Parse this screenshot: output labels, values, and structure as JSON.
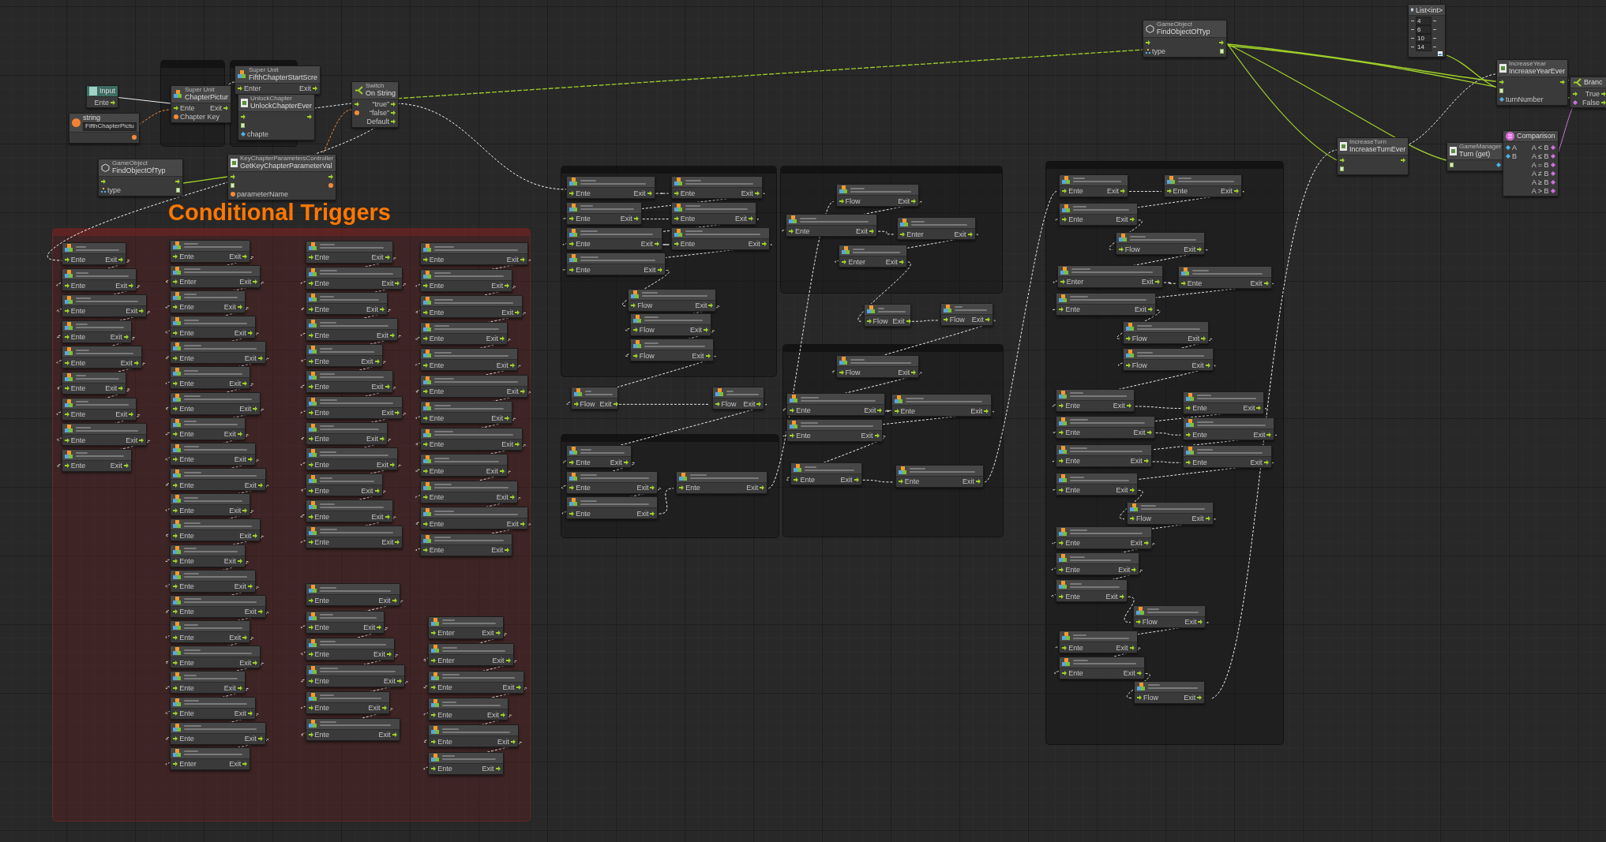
{
  "title_label": "Conditional Triggers",
  "top_nodes": [
    {
      "kind": "input",
      "title": "Input",
      "rows": [
        {
          "right": {
            "kind": "flow",
            "label": "Ente"
          }
        }
      ]
    },
    {
      "kind": "literal",
      "title": "string",
      "value": "FifthChapterPictu",
      "rows": [
        {
          "right": {
            "kind": "string"
          }
        }
      ]
    },
    {
      "kind": "super",
      "category": "Super Unit",
      "title": "ChapterPictur",
      "rows": [
        {
          "left": {
            "kind": "flow",
            "label": "Ente"
          },
          "right": {
            "kind": "flow",
            "label": "Exit"
          }
        },
        {
          "left": {
            "kind": "string",
            "label": "Chapter Key"
          }
        }
      ]
    },
    {
      "kind": "super",
      "category": "Super Unit",
      "title": "FifthChapterStartScre",
      "rows": [
        {
          "left": {
            "kind": "flow",
            "label": "Enter"
          },
          "right": {
            "kind": "flow",
            "label": "Exit"
          }
        }
      ]
    },
    {
      "kind": "script",
      "category": "UnlockChapter",
      "title": "UnlockChapterEver",
      "rows": [
        {
          "left": {
            "kind": "flow"
          },
          "right": {
            "kind": "flow"
          }
        },
        {
          "left": {
            "kind": "object"
          }
        },
        {
          "left": {
            "kind": "int",
            "label": "chapte"
          }
        }
      ]
    },
    {
      "kind": "switch",
      "category": "Switch",
      "title": "On String",
      "rows": [
        {
          "left": {
            "kind": "flow"
          },
          "right": {
            "kind": "flow",
            "label": "“true”"
          }
        },
        {
          "left": {
            "kind": "string"
          },
          "right": {
            "kind": "flow",
            "label": "“false”"
          }
        },
        {
          "right": {
            "kind": "flow",
            "label": "Default"
          }
        }
      ]
    },
    {
      "kind": "gameobject",
      "category": "GameObject",
      "title": "FindObjectOfTyp",
      "rows": [
        {
          "left": {
            "kind": "flow"
          },
          "right": {
            "kind": "flow"
          }
        },
        {
          "left": {
            "kind": "type",
            "label": "type"
          },
          "right": {
            "kind": "object"
          }
        }
      ]
    },
    {
      "kind": "script",
      "category": "KeyChapterParametersController",
      "title": "GetKeyChapterParameterVal",
      "rows": [
        {
          "left": {
            "kind": "flow"
          },
          "right": {
            "kind": "flow"
          }
        },
        {
          "left": {
            "kind": "object"
          },
          "right": {
            "kind": "string"
          }
        },
        {
          "left": {
            "kind": "string",
            "label": "parameterName"
          }
        }
      ]
    },
    {
      "kind": "gameobject",
      "category": "GameObject",
      "title": "FindObjectOfTyp",
      "rows": [
        {
          "left": {
            "kind": "flow"
          },
          "right": {
            "kind": "flow"
          }
        },
        {
          "left": {
            "kind": "type",
            "label": "type"
          },
          "right": {
            "kind": "object"
          }
        }
      ]
    },
    {
      "kind": "script",
      "category": "IncreaseYear",
      "title": "IncreaseYearEver",
      "rows": [
        {
          "left": {
            "kind": "flow"
          },
          "right": {
            "kind": "flow"
          }
        },
        {
          "left": {
            "kind": "object"
          }
        },
        {
          "left": {
            "kind": "int",
            "label": "turnNumber"
          }
        }
      ]
    },
    {
      "kind": "branch",
      "title": "Branc",
      "rows": [
        {
          "left": {
            "kind": "flow"
          },
          "right": {
            "kind": "flow",
            "label": "True"
          }
        },
        {
          "left": {
            "kind": "bool"
          },
          "right": {
            "kind": "flow",
            "label": "False"
          }
        }
      ]
    },
    {
      "kind": "script",
      "category": "IncreaseTurn",
      "title": "IncreaseTurnEver",
      "rows": [
        {
          "left": {
            "kind": "flow"
          },
          "right": {
            "kind": "flow"
          }
        },
        {
          "left": {
            "kind": "object"
          }
        }
      ]
    },
    {
      "kind": "script",
      "category": "GameManager",
      "title": "Turn (get)",
      "rows": [
        {
          "left": {
            "kind": "object"
          },
          "right": {
            "kind": "int"
          }
        }
      ]
    },
    {
      "kind": "comparison",
      "title": "Comparison",
      "rows": [
        {
          "left": {
            "kind": "int",
            "label": "A"
          },
          "right": {
            "kind": "bool",
            "label": "A < B"
          }
        },
        {
          "left": {
            "kind": "int",
            "label": "B"
          },
          "right": {
            "kind": "bool",
            "label": "A ≤ B"
          }
        },
        {
          "right": {
            "kind": "bool",
            "label": "A = B"
          }
        },
        {
          "right": {
            "kind": "bool",
            "label": "A ≠ B"
          }
        },
        {
          "right": {
            "kind": "bool",
            "label": "A ≥ B"
          }
        },
        {
          "right": {
            "kind": "bool",
            "label": "A > B"
          }
        }
      ]
    }
  ],
  "list_node": {
    "title": "List<int>",
    "items": [
      "4",
      "6",
      "10",
      "14"
    ]
  },
  "trigger_columns": [
    {
      "nodes": [
        {
          "enter": "Ente",
          "exit": "Exit"
        },
        {
          "enter": "Ente",
          "exit": "Exit"
        },
        {
          "enter": "Ente",
          "exit": "Exit"
        },
        {
          "enter": "Ente",
          "exit": "Exit"
        },
        {
          "enter": "Ente",
          "exit": "Exit"
        },
        {
          "enter": "Ente",
          "exit": "Exit"
        },
        {
          "enter": "Ente",
          "exit": "Exit"
        },
        {
          "enter": "Ente",
          "exit": "Exit"
        },
        {
          "enter": "Ente",
          "exit": "Exit"
        }
      ]
    },
    {
      "nodes": [
        {
          "enter": "Ente",
          "exit": "Exit"
        },
        {
          "enter": "Enter",
          "exit": "Exit"
        },
        {
          "enter": "Ente",
          "exit": "Exit"
        },
        {
          "enter": "Ente",
          "exit": "Exit"
        },
        {
          "enter": "Ente",
          "exit": "Exit"
        },
        {
          "enter": "Ente",
          "exit": "Exit"
        },
        {
          "enter": "Ente",
          "exit": "Exit"
        },
        {
          "enter": "Ente",
          "exit": "Exit"
        },
        {
          "enter": "Ente",
          "exit": "Exit"
        },
        {
          "enter": "Ente",
          "exit": "Exit"
        },
        {
          "enter": "Ente",
          "exit": "Exit"
        },
        {
          "enter": "Ente",
          "exit": "Exit"
        },
        {
          "enter": "Ente",
          "exit": "Exit"
        },
        {
          "enter": "Ente",
          "exit": "Exit"
        },
        {
          "enter": "Ente",
          "exit": "Exit"
        },
        {
          "enter": "Ente",
          "exit": "Exit"
        },
        {
          "enter": "Ente",
          "exit": "Exit"
        },
        {
          "enter": "Ente",
          "exit": "Exit"
        },
        {
          "enter": "Ente",
          "exit": "Exit"
        },
        {
          "enter": "Ente",
          "exit": "Exit"
        },
        {
          "enter": "Enter",
          "exit": "Exit"
        }
      ]
    },
    {
      "nodes": [
        {
          "enter": "Ente",
          "exit": "Exit"
        },
        {
          "enter": "Ente",
          "exit": "Exit"
        },
        {
          "enter": "Ente",
          "exit": "Exit"
        },
        {
          "enter": "Ente",
          "exit": "Exit"
        },
        {
          "enter": "Ente",
          "exit": "Exit"
        },
        {
          "enter": "Ente",
          "exit": "Exit"
        },
        {
          "enter": "Ente",
          "exit": "Exit"
        },
        {
          "enter": "Ente",
          "exit": "Exit"
        },
        {
          "enter": "Ente",
          "exit": "Exit"
        },
        {
          "enter": "Ente",
          "exit": "Exit"
        },
        {
          "enter": "Ente",
          "exit": "Exit"
        },
        {
          "enter": "Ente",
          "exit": "Exit"
        }
      ]
    },
    {
      "nodes": [
        {
          "enter": "Ente",
          "exit": "Exit"
        },
        {
          "enter": "Ente",
          "exit": "Exit"
        },
        {
          "enter": "Ente",
          "exit": "Exit"
        },
        {
          "enter": "Ente",
          "exit": "Exit"
        },
        {
          "enter": "Ente",
          "exit": "Exit"
        },
        {
          "enter": "Ente",
          "exit": "Exit"
        }
      ]
    },
    {
      "nodes": [
        {
          "enter": "Ente",
          "exit": "Exit"
        },
        {
          "enter": "Ente",
          "exit": "Exit"
        },
        {
          "enter": "Ente",
          "exit": "Exit"
        },
        {
          "enter": "Ente",
          "exit": "Exit"
        },
        {
          "enter": "Ente",
          "exit": "Exit"
        },
        {
          "enter": "Ente",
          "exit": "Exit"
        },
        {
          "enter": "Ente",
          "exit": "Exit"
        },
        {
          "enter": "Ente",
          "exit": "Exit"
        },
        {
          "enter": "Ente",
          "exit": "Exit"
        },
        {
          "enter": "Ente",
          "exit": "Exit"
        },
        {
          "enter": "Ente",
          "exit": "Exit"
        },
        {
          "enter": "Ente",
          "exit": "Exit"
        }
      ]
    },
    {
      "nodes": [
        {
          "enter": "Enter",
          "exit": "Exit"
        },
        {
          "enter": "Enter",
          "exit": "Exit"
        },
        {
          "enter": "Ente",
          "exit": "Exit"
        },
        {
          "enter": "Ente",
          "exit": "Exit"
        },
        {
          "enter": "Ente",
          "exit": "Exit"
        },
        {
          "enter": "Ente",
          "exit": "Exit"
        }
      ]
    }
  ],
  "unit_nodes": [
    {
      "enter": "Ente",
      "exit": "Exit"
    },
    {
      "enter": "Ente",
      "exit": "Exit"
    },
    {
      "enter": "Ente",
      "exit": "Exit"
    },
    {
      "enter": "Ente",
      "exit": "Exit"
    },
    {
      "enter": "Ente",
      "exit": "Exit"
    },
    {
      "enter": "Ente",
      "exit": "Exit"
    },
    {
      "enter": "Ente",
      "exit": "Exit"
    },
    {
      "enter": "Flow",
      "exit": "Exit"
    },
    {
      "enter": "Flow",
      "exit": "Exit"
    },
    {
      "enter": "Flow",
      "exit": "Exit"
    },
    {
      "enter": "Flow",
      "exit": "Exit"
    },
    {
      "enter": "Flow",
      "exit": "Exit"
    },
    {
      "enter": "Ente",
      "exit": "Exit"
    },
    {
      "enter": "Ente",
      "exit": "Exit"
    },
    {
      "enter": "Ente",
      "exit": "Exit"
    },
    {
      "enter": "Ente",
      "exit": "Exit"
    },
    {
      "enter": "Flow",
      "exit": "Exit"
    },
    {
      "enter": "Ente",
      "exit": "Exit"
    },
    {
      "enter": "Enter",
      "exit": "Exit"
    },
    {
      "enter": "Enter",
      "exit": "Exit"
    },
    {
      "enter": "Flow",
      "exit": "Exit"
    },
    {
      "enter": "Flow",
      "exit": "Exit"
    },
    {
      "enter": "Flow",
      "exit": "Exit"
    },
    {
      "enter": "Ente",
      "exit": "Exit"
    },
    {
      "enter": "Ente",
      "exit": "Exit"
    },
    {
      "enter": "Ente",
      "exit": "Exit"
    },
    {
      "enter": "Ente",
      "exit": "Exit"
    },
    {
      "enter": "Ente",
      "exit": "Exit"
    },
    {
      "enter": "Ente",
      "exit": "Exit"
    },
    {
      "enter": "Ente",
      "exit": "Exit"
    },
    {
      "enter": "Ente",
      "exit": "Exit"
    },
    {
      "enter": "Flow",
      "exit": "Exit"
    },
    {
      "enter": "Enter",
      "exit": "Exit"
    },
    {
      "enter": "Ente",
      "exit": "Exit"
    },
    {
      "enter": "Ente",
      "exit": "Exit"
    },
    {
      "enter": "Flow",
      "exit": "Exit"
    },
    {
      "enter": "Flow",
      "exit": "Exit"
    },
    {
      "enter": "Ente",
      "exit": "Exit"
    },
    {
      "enter": "Ente",
      "exit": "Exit"
    },
    {
      "enter": "Ente",
      "exit": "Exit"
    },
    {
      "enter": "Ente",
      "exit": "Exit"
    },
    {
      "enter": "Ente",
      "exit": "Exit"
    },
    {
      "enter": "Ente",
      "exit": "Exit"
    },
    {
      "enter": "Ente",
      "exit": "Exit"
    },
    {
      "enter": "Flow",
      "exit": "Exit"
    },
    {
      "enter": "Ente",
      "exit": "Exit"
    },
    {
      "enter": "Ente",
      "exit": "Exit"
    },
    {
      "enter": "Ente",
      "exit": "Exit"
    },
    {
      "enter": "Flow",
      "exit": "Exit"
    },
    {
      "enter": "Ente",
      "exit": "Exit"
    },
    {
      "enter": "Ente",
      "exit": "Exit"
    },
    {
      "enter": "Flow",
      "exit": "Exit"
    }
  ]
}
